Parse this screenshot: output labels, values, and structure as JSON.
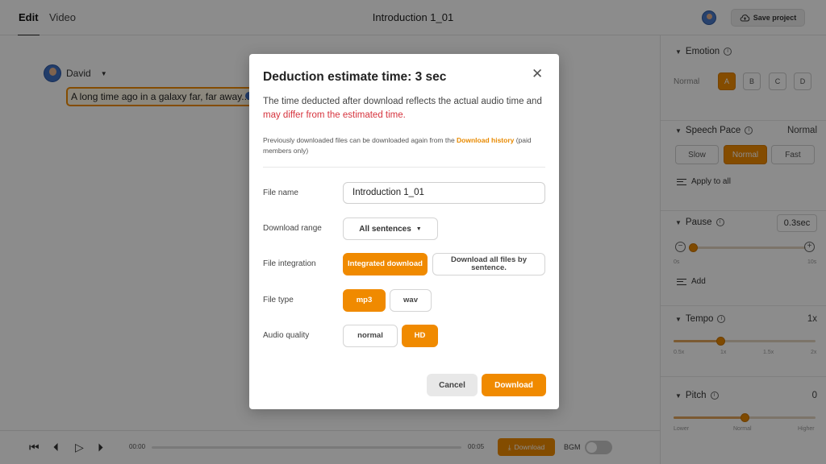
{
  "topbar": {
    "tabs": [
      {
        "label": "Edit"
      },
      {
        "label": "Video"
      }
    ],
    "project_title": "Introduction 1_01",
    "save_label": "Save project"
  },
  "editor": {
    "speaker_name": "David",
    "sentence_text": "A long time ago in a galaxy far, far away..."
  },
  "panel": {
    "emotion": {
      "label": "Emotion",
      "level_label": "Normal",
      "options": [
        "A",
        "B",
        "C",
        "D"
      ],
      "selected": "A"
    },
    "speech_pace": {
      "label": "Speech Pace",
      "value": "Normal",
      "options": [
        "Slow",
        "Normal",
        "Fast"
      ],
      "selected": "Normal",
      "apply_all": "Apply to all"
    },
    "pause": {
      "label": "Pause",
      "value": "0.3sec",
      "min_label": "0s",
      "max_label": "10s",
      "add_label": "Add",
      "level": 0.03
    },
    "tempo": {
      "label": "Tempo",
      "value": "1x",
      "ticks": [
        "0.5x",
        "1x",
        "1.5x",
        "2x"
      ],
      "level": 0.33
    },
    "pitch": {
      "label": "Pitch",
      "value": "0",
      "ticks": [
        "Lower",
        "Normal",
        "Higher"
      ],
      "level": 0.5
    }
  },
  "player": {
    "current_time": "00:00",
    "total_time": "00:05",
    "download_label": "Download",
    "bgm_label": "BGM",
    "bgm_on": false
  },
  "modal": {
    "title": "Deduction estimate time: 3 sec",
    "desc_part1": "The time deducted after download reflects the actual audio time and ",
    "desc_red": "may differ from the estimated time.",
    "note_part1": "Previously downloaded files can be downloaded again from the ",
    "note_link": "Download history",
    "note_part2": " (paid members only)",
    "file_name_label": "File name",
    "file_name_value": "Introduction 1_01",
    "range_label": "Download range",
    "range_value": "All sentences",
    "integration_label": "File integration",
    "integration_options": [
      "Integrated download",
      "Download all files by sentence."
    ],
    "integration_selected": "Integrated download",
    "type_label": "File type",
    "type_options": [
      "mp3",
      "wav"
    ],
    "type_selected": "mp3",
    "quality_label": "Audio quality",
    "quality_options": [
      "normal",
      "HD"
    ],
    "quality_selected": "HD",
    "cancel_label": "Cancel",
    "download_label": "Download"
  },
  "colors": {
    "accent": "#f08a00",
    "warning_text": "#d6333d"
  }
}
